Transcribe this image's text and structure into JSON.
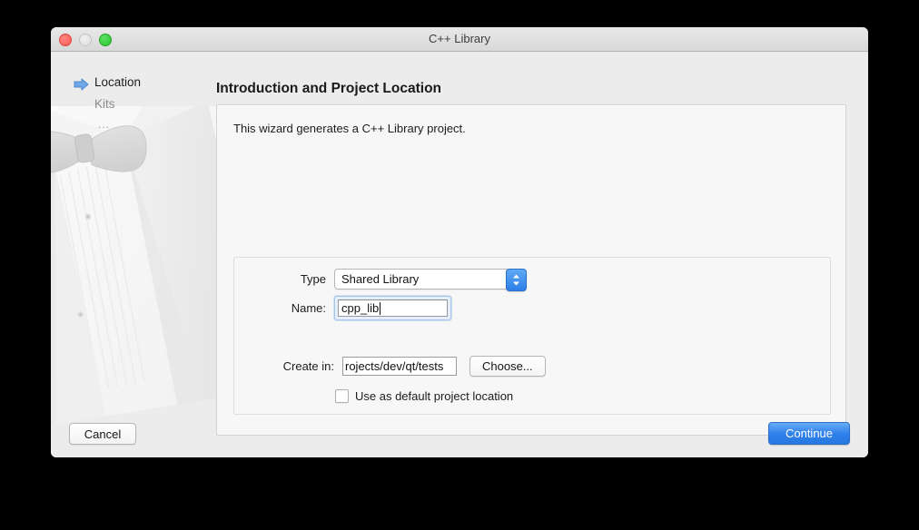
{
  "window": {
    "title": "C++ Library",
    "traffic_lights": [
      {
        "name": "close",
        "color": "#fa5e57"
      },
      {
        "name": "minimize",
        "color": "#dddddd"
      },
      {
        "name": "zoom",
        "color": "#2ac32f"
      }
    ]
  },
  "sidebar": {
    "items": [
      {
        "label": "Location",
        "active": true,
        "icon": "right-arrow-icon"
      },
      {
        "label": "Kits",
        "active": false,
        "icon": ""
      }
    ],
    "more": "..."
  },
  "page": {
    "header": "Introduction and Project Location",
    "intro": "This wizard generates a C++ Library project."
  },
  "form": {
    "type_label": "Type",
    "type_value": "Shared Library",
    "type_stepper_icon": "stepper-updown-icon",
    "name_label": "Name:",
    "name_value": "cpp_lib",
    "create_in_label": "Create in:",
    "create_in_value": "rojects/dev/qt/tests",
    "choose_label": "Choose...",
    "default_location_label": "Use as default project location",
    "default_location_checked": false
  },
  "footer": {
    "cancel_label": "Cancel",
    "continue_label": "Continue"
  },
  "colors": {
    "accent": "#2f80ea",
    "window_bg": "#ececec",
    "panel_bg": "#f7f7f7",
    "title_text": "#3d3d3d"
  }
}
